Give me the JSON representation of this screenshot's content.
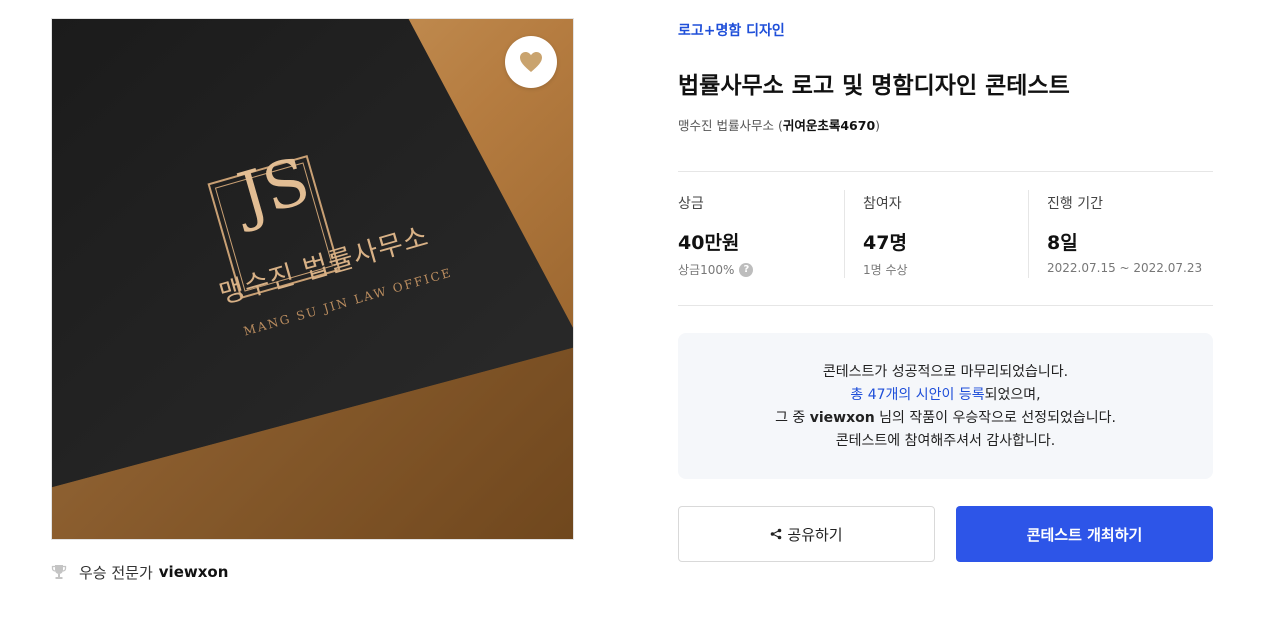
{
  "image": {
    "logo_monogram": "JS",
    "logo_name_ko": "맹수진 법률사무소",
    "logo_name_en": "MANG SU JIN LAW OFFICE"
  },
  "expert": {
    "label": "우승 전문가",
    "name": "viewxon"
  },
  "contest": {
    "category": "로고+명함 디자인",
    "title": "법률사무소 로고 및 명함디자인 콘테스트",
    "holder_name": "맹수진 법률사무소",
    "holder_id": "귀여운초록4670"
  },
  "stats": [
    {
      "label": "상금",
      "value": "40만원",
      "sub": "상금100%"
    },
    {
      "label": "참여자",
      "value": "47명",
      "sub": "1명 수상"
    },
    {
      "label": "진행 기간",
      "value": "8일",
      "sub": "2022.07.15 ~ 2022.07.23"
    }
  ],
  "notice": {
    "line1": "콘테스트가 성공적으로 마무리되었습니다.",
    "line2_link": "총 47개의 시안이 등록",
    "line2_rest": "되었으며,",
    "line3_pre": "그 중 ",
    "line3_name": "viewxon",
    "line3_post": " 님의 작품이 우승작으로 선정되었습니다.",
    "line4": "콘테스트에 참여해주셔서 감사합니다."
  },
  "buttons": {
    "share": "공유하기",
    "host": "콘테스트 개최하기"
  },
  "colors": {
    "accent": "#2d55e8",
    "category": "#1f4fd9"
  }
}
